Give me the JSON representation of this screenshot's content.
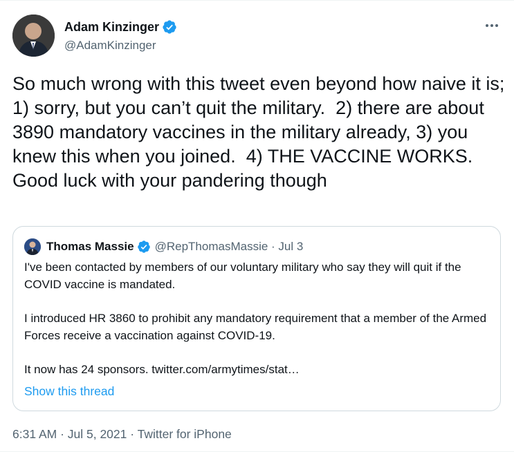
{
  "author": {
    "name": "Adam Kinzinger",
    "handle": "@AdamKinzinger",
    "verified": true
  },
  "tweet": {
    "text": "So much wrong with this tweet even beyond how naive it is; 1) sorry, but you can’t quit the military.  2) there are about 3890 mandatory vaccines in the military already, 3) you knew this when you joined.  4) THE VACCINE WORKS. Good luck with your pandering though"
  },
  "quoted": {
    "name": "Thomas Massie",
    "meta": "@RepThomasMassie · Jul 3",
    "verified": true,
    "paragraphs": [
      "I've been contacted by members of our voluntary military who say they will quit if the COVID vaccine is mandated.",
      "I introduced HR 3860 to prohibit any mandatory requirement that a member of the Armed Forces receive a vaccination against COVID-19.",
      "It now has 24 sponsors. twitter.com/armytimes/stat…"
    ],
    "show_thread": "Show this thread"
  },
  "footer": {
    "timestamp": "6:31 AM · Jul 5, 2021 · Twitter for iPhone"
  },
  "icons": {
    "more": "more-icon",
    "verified": "verified-badge-icon"
  },
  "colors": {
    "accent": "#1d9bf0",
    "secondary_text": "#536471",
    "border": "#cfd9de"
  }
}
